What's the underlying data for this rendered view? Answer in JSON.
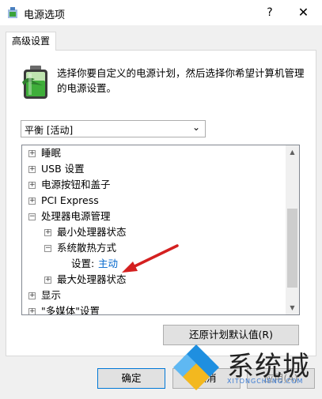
{
  "window": {
    "title": "电源选项",
    "help": "?",
    "close": "✕"
  },
  "tab": {
    "label": "高级设置"
  },
  "description": "选择你要自定义的电源计划，然后选择你希望计算机管理的电源设置。",
  "plan_select": {
    "value": "平衡 [活动]"
  },
  "tree": {
    "items": [
      {
        "label": "睡眠",
        "expander": "+"
      },
      {
        "label": "USB 设置",
        "expander": "+"
      },
      {
        "label": "电源按钮和盖子",
        "expander": "+"
      },
      {
        "label": "PCI Express",
        "expander": "+"
      },
      {
        "label": "处理器电源管理",
        "expander": "−"
      },
      {
        "label": "最小处理器状态",
        "expander": "+"
      },
      {
        "label": "系统散热方式",
        "expander": "−"
      },
      {
        "label": "设置:",
        "value": "主动"
      },
      {
        "label": "最大处理器状态",
        "expander": "+"
      },
      {
        "label": "显示",
        "expander": "+"
      },
      {
        "label": "\"多媒体\"设置",
        "expander": "+"
      }
    ]
  },
  "buttons": {
    "restore": "还原计划默认值(R)",
    "ok": "确定",
    "cancel": "取消",
    "apply": "应用(A)"
  },
  "watermark": {
    "text": "系统城",
    "sub": "XITONGCHENG.COM"
  },
  "colors": {
    "accent": "#0078d7",
    "link": "#0066cc",
    "annotation_arrow": "#d42020"
  }
}
